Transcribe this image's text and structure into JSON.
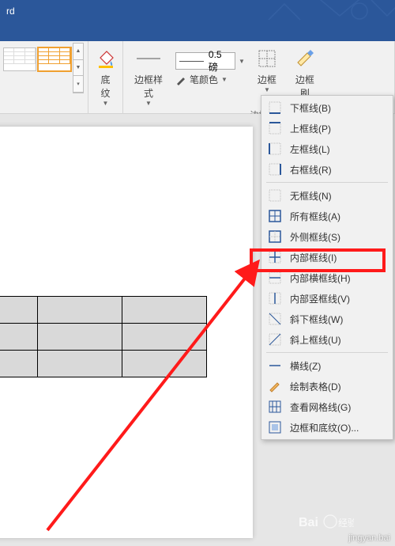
{
  "title_suffix": "rd",
  "ribbon": {
    "shading_label": "底纹",
    "border_style_label": "边框样式",
    "weight_value": "0.5 磅",
    "pen_color_label": "笔颜色",
    "border_group_label": "边框",
    "border_btn_label": "边框",
    "painter_label": "边框刷"
  },
  "dropdown": {
    "items": [
      {
        "label": "下框线(B)"
      },
      {
        "label": "上框线(P)"
      },
      {
        "label": "左框线(L)"
      },
      {
        "label": "右框线(R)"
      },
      {
        "sep": true
      },
      {
        "label": "无框线(N)"
      },
      {
        "label": "所有框线(A)"
      },
      {
        "label": "外侧框线(S)"
      },
      {
        "label": "内部框线(I)"
      },
      {
        "label": "内部横框线(H)"
      },
      {
        "label": "内部竖框线(V)"
      },
      {
        "label": "斜下框线(W)"
      },
      {
        "label": "斜上框线(U)"
      },
      {
        "sep": true
      },
      {
        "label": "横线(Z)"
      },
      {
        "label": "绘制表格(D)"
      },
      {
        "label": "查看网格线(G)"
      },
      {
        "label": "边框和底纹(O)..."
      }
    ]
  },
  "watermark": {
    "brand": "Bai",
    "sub": "经验",
    "url": "jingyan.bai"
  }
}
